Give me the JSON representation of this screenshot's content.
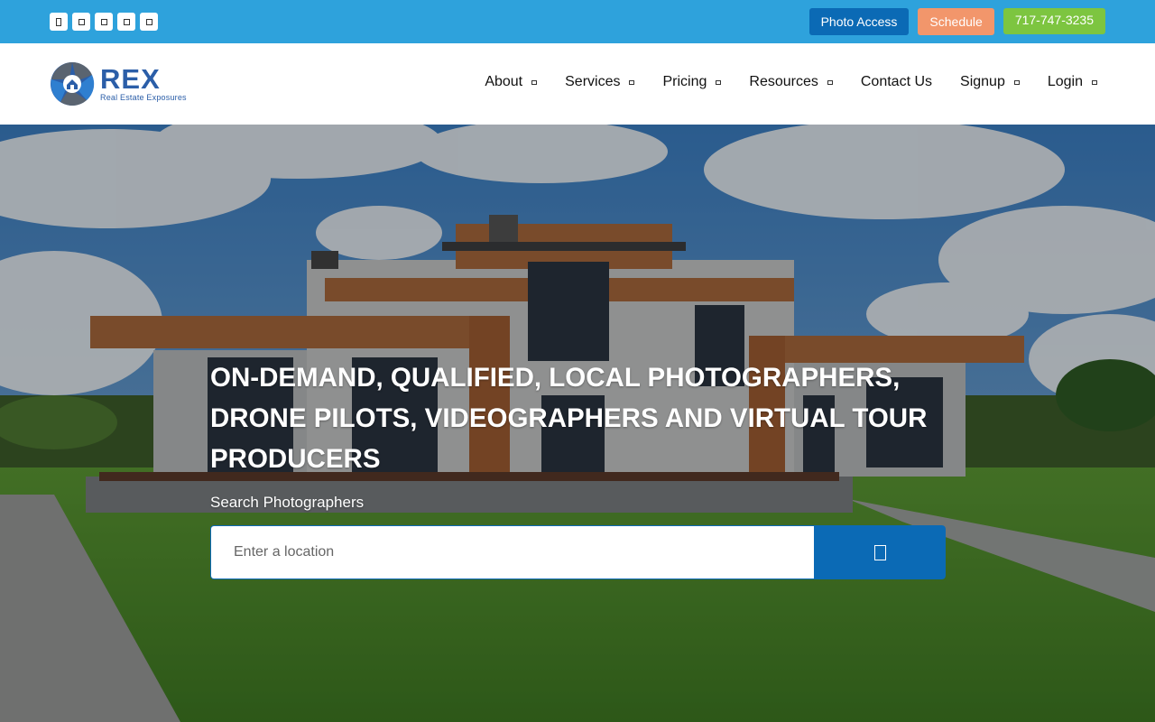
{
  "topbar": {
    "social_icons": [
      "facebook-icon",
      "twitter-icon",
      "instagram-icon",
      "linkedin-icon",
      "youtube-icon"
    ],
    "photo_access_label": "Photo Access",
    "schedule_label": "Schedule",
    "phone_label": "717-747-3235"
  },
  "logo": {
    "wordmark": "REX",
    "tagline": "Real Estate Exposures"
  },
  "nav": {
    "items": [
      {
        "label": "About",
        "has_dropdown": true
      },
      {
        "label": "Services",
        "has_dropdown": true
      },
      {
        "label": "Pricing",
        "has_dropdown": true
      },
      {
        "label": "Resources",
        "has_dropdown": true
      },
      {
        "label": "Contact Us",
        "has_dropdown": false
      },
      {
        "label": "Signup",
        "has_dropdown": true
      },
      {
        "label": "Login",
        "has_dropdown": true
      }
    ]
  },
  "hero": {
    "headline": "ON-DEMAND, QUALIFIED, LOCAL PHOTOGRAPHERS, DRONE PILOTS, VIDEOGRAPHERS AND VIRTUAL TOUR PRODUCERS",
    "search_label": "Search Photographers",
    "search_placeholder": "Enter a location",
    "search_icon": "search-icon"
  },
  "colors": {
    "topbar": "#2ea2dc",
    "primary_blue": "#0b6ab5",
    "schedule_orange": "#f2966b",
    "phone_green": "#7dc540",
    "logo_blue": "#2b5ea8"
  }
}
